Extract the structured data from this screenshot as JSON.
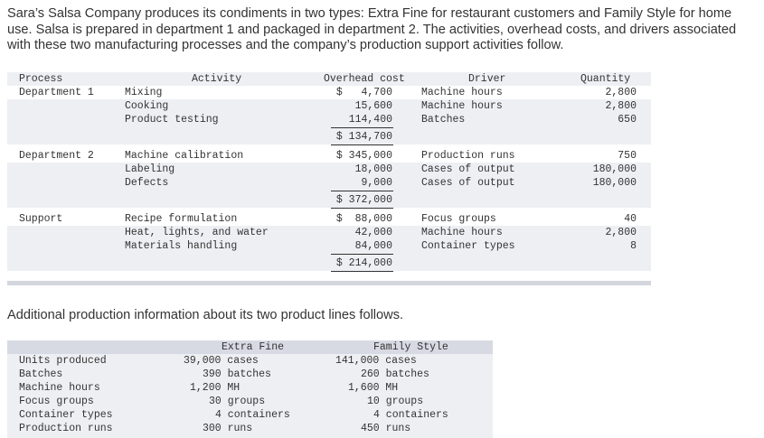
{
  "intro": "Sara’s Salsa Company produces its condiments in two types: Extra Fine for restaurant customers and Family Style for home use. Salsa is prepared in department 1 and packaged in department 2. The activities, overhead costs, and drivers associated with these two manufacturing processes and the company’s production support activities follow.",
  "table1": {
    "headers": {
      "process": "Process",
      "activity": "Activity",
      "overhead": "Overhead cost",
      "driver": "Driver",
      "quantity": "Quantity"
    },
    "groups": [
      {
        "process": "Department 1",
        "rows": [
          {
            "activity": "Mixing",
            "cost": "$   4,700",
            "driver": "Machine hours",
            "qty": "2,800"
          },
          {
            "activity": "Cooking",
            "cost": "15,600",
            "driver": "Machine hours",
            "qty": "2,800"
          },
          {
            "activity": "Product testing",
            "cost": "114,400",
            "driver": "Batches",
            "qty": "650"
          }
        ],
        "total": "$ 134,700"
      },
      {
        "process": "Department 2",
        "rows": [
          {
            "activity": "Machine calibration",
            "cost": "$ 345,000",
            "driver": "Production runs",
            "qty": "750"
          },
          {
            "activity": "Labeling",
            "cost": "18,000",
            "driver": "Cases of output",
            "qty": "180,000"
          },
          {
            "activity": "Defects",
            "cost": "9,000",
            "driver": "Cases of output",
            "qty": "180,000"
          }
        ],
        "total": "$ 372,000"
      },
      {
        "process": "Support",
        "rows": [
          {
            "activity": "Recipe formulation",
            "cost": "$  88,000",
            "driver": "Focus groups",
            "qty": "40"
          },
          {
            "activity": "Heat, lights, and water",
            "cost": "42,000",
            "driver": "Machine hours",
            "qty": "2,800"
          },
          {
            "activity": "Materials handling",
            "cost": "84,000",
            "driver": "Container types",
            "qty": "8"
          }
        ],
        "total": "$ 214,000"
      }
    ]
  },
  "subtitle": "Additional production information about its two product lines follows.",
  "table2": {
    "headers": {
      "extra": "Extra Fine",
      "family": "Family Style"
    },
    "rows": [
      {
        "label": "Units produced",
        "extra": "39,000 cases",
        "family": "141,000 cases"
      },
      {
        "label": "Batches",
        "extra": "390 batches",
        "family": "260 batches"
      },
      {
        "label": "Machine hours",
        "extra": "1,200 MH",
        "family": "1,600 MH"
      },
      {
        "label": "Focus groups",
        "extra": "30 groups",
        "family": "10 groups"
      },
      {
        "label": "Container types",
        "extra": "4 containers",
        "family": "4 containers"
      },
      {
        "label": "Production runs",
        "extra": "300 runs",
        "family": "450 runs"
      }
    ]
  }
}
